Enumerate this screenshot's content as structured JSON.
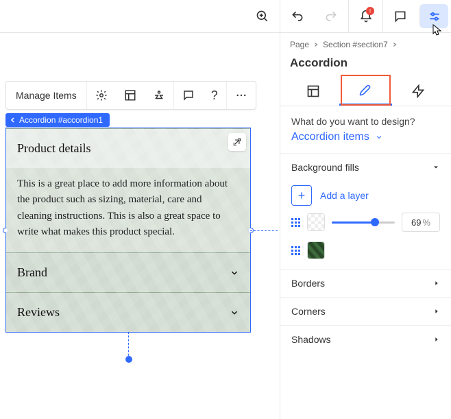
{
  "topbar": {
    "bell_badge": "!"
  },
  "floatbar": {
    "manage": "Manage Items"
  },
  "pill": {
    "label": "Accordion #accordion1"
  },
  "accordion": {
    "item1_title": "Product details",
    "item1_body": "This is a great place to add more information about the product such as sizing, material, care and cleaning instructions. This is also a great space to write what makes this product special.",
    "item2_title": "Brand",
    "item3_title": "Reviews"
  },
  "breadcrumbs": {
    "a": "Page",
    "b": "Section #section7"
  },
  "panel": {
    "title": "Accordion",
    "question": "What do you want to design?",
    "target": "Accordion items",
    "bg_fills": "Background fills",
    "add_layer": "Add a layer",
    "opacity_pct": "69",
    "pct_unit": "%",
    "borders": "Borders",
    "corners": "Corners",
    "shadows": "Shadows"
  }
}
